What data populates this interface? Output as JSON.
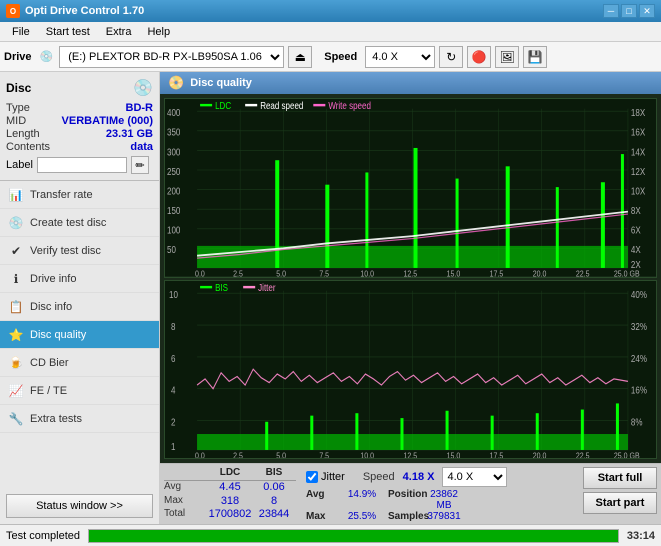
{
  "app": {
    "title": "Opti Drive Control 1.70",
    "icon": "O"
  },
  "titlebar": {
    "minimize": "─",
    "maximize": "□",
    "close": "✕"
  },
  "menu": {
    "items": [
      "File",
      "Start test",
      "Extra",
      "Help"
    ]
  },
  "toolbar": {
    "drive_label": "Drive",
    "drive_value": "(E:)  PLEXTOR BD-R  PX-LB950SA 1.06",
    "speed_label": "Speed",
    "speed_value": "4.0 X"
  },
  "disc": {
    "title": "Disc",
    "type_label": "Type",
    "type_value": "BD-R",
    "mid_label": "MID",
    "mid_value": "VERBATIMe (000)",
    "length_label": "Length",
    "length_value": "23.31 GB",
    "contents_label": "Contents",
    "contents_value": "data",
    "label_label": "Label",
    "label_value": ""
  },
  "nav": {
    "items": [
      {
        "id": "transfer-rate",
        "label": "Transfer rate",
        "icon": "📊"
      },
      {
        "id": "create-test-disc",
        "label": "Create test disc",
        "icon": "💿"
      },
      {
        "id": "verify-test-disc",
        "label": "Verify test disc",
        "icon": "✔"
      },
      {
        "id": "drive-info",
        "label": "Drive info",
        "icon": "ℹ"
      },
      {
        "id": "disc-info",
        "label": "Disc info",
        "icon": "📋"
      },
      {
        "id": "disc-quality",
        "label": "Disc quality",
        "icon": "⭐",
        "active": true
      },
      {
        "id": "cd-bier",
        "label": "CD Bier",
        "icon": "🍺"
      },
      {
        "id": "fe-te",
        "label": "FE / TE",
        "icon": "📈"
      },
      {
        "id": "extra-tests",
        "label": "Extra tests",
        "icon": "🔧"
      }
    ],
    "status_btn": "Status window >>"
  },
  "chart": {
    "title": "Disc quality",
    "upper": {
      "legend": [
        {
          "label": "LDC",
          "color": "#00ff00"
        },
        {
          "label": "Read speed",
          "color": "#ffffff"
        },
        {
          "label": "Write speed",
          "color": "#ff66cc"
        }
      ],
      "y_right_max": "18X",
      "y_right_labels": [
        "18X",
        "16X",
        "14X",
        "12X",
        "10X",
        "8X",
        "6X",
        "4X",
        "2X"
      ],
      "y_left_max": "400",
      "x_labels": [
        "0.0",
        "2.5",
        "5.0",
        "7.5",
        "10.0",
        "12.5",
        "15.0",
        "17.5",
        "20.0",
        "22.5",
        "25.0 GB"
      ]
    },
    "lower": {
      "legend": [
        {
          "label": "BIS",
          "color": "#00ff00"
        },
        {
          "label": "Jitter",
          "color": "#ff66cc"
        }
      ],
      "y_right_labels": [
        "40%",
        "32%",
        "24%",
        "16%",
        "8%"
      ],
      "y_left_max": "10",
      "x_labels": [
        "0.0",
        "2.5",
        "5.0",
        "7.5",
        "10.0",
        "12.5",
        "15.0",
        "17.5",
        "20.0",
        "22.5",
        "25.0 GB"
      ]
    }
  },
  "stats": {
    "headers": [
      "",
      "LDC",
      "BIS"
    ],
    "rows": [
      {
        "label": "Avg",
        "ldc": "4.45",
        "bis": "0.06"
      },
      {
        "label": "Max",
        "ldc": "318",
        "bis": "8"
      },
      {
        "label": "Total",
        "ldc": "1700802",
        "bis": "23844"
      }
    ],
    "jitter": {
      "checked": true,
      "label": "Jitter",
      "avg": "14.9%",
      "max": "25.5%"
    },
    "speed_label": "Speed",
    "speed_value": "4.18 X",
    "speed_select": "4.0 X",
    "position_label": "Position",
    "position_value": "23862 MB",
    "samples_label": "Samples",
    "samples_value": "379831",
    "buttons": {
      "start_full": "Start full",
      "start_part": "Start part"
    }
  },
  "statusbar": {
    "text": "Test completed",
    "progress": 100,
    "time": "33:14"
  }
}
